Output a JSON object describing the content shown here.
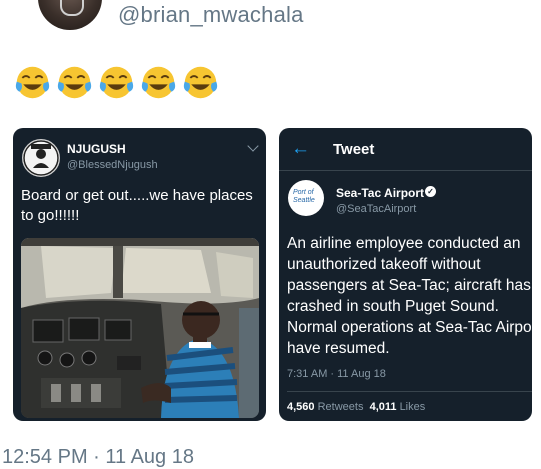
{
  "outer_tweet": {
    "handle": "@brian_mwachala",
    "emoji": [
      "😂",
      "😂",
      "😂",
      "😂",
      "😂"
    ],
    "timestamp": "12:54 PM · 11 Aug 18"
  },
  "left_tweet": {
    "name": "NJUGUSH",
    "handle": "@BlessedNjugush",
    "text": "Board or get out.....we have places to go!!!!!!",
    "logo_text": "Blessed"
  },
  "right_tweet": {
    "header_title": "Tweet",
    "name": "Sea-Tac Airport",
    "handle": "@SeaTacAirport",
    "logo_text": "Port of Seattle",
    "text": "An airline employee conducted an unauthorized takeoff without passengers at Sea-Tac; aircraft has crashed in south Puget Sound. Normal operations at Sea-Tac Airport have resumed.",
    "time": "7:31 AM · 11 Aug 18",
    "retweets_count": "4,560",
    "retweets_label": "Retweets",
    "likes_count": "4,011",
    "likes_label": "Likes"
  },
  "colors": {
    "card_bg": "#15202b",
    "accent": "#1da1f2",
    "muted": "#8899a6"
  }
}
